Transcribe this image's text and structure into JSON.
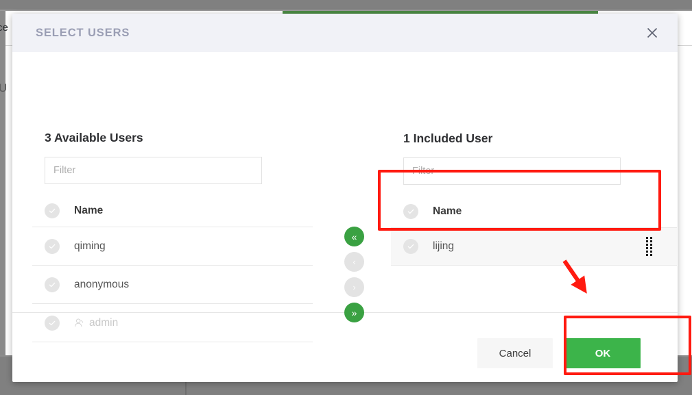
{
  "background": {
    "fragment_top_left": "ce",
    "fragment_left": "U"
  },
  "dialog": {
    "title": "SELECT USERS",
    "close_icon": "close-icon"
  },
  "available": {
    "heading": "3 Available Users",
    "filter_placeholder": "Filter",
    "column_header": "Name",
    "rows": [
      {
        "name": "qiming",
        "icon": "",
        "dim": false
      },
      {
        "name": "anonymous",
        "icon": "",
        "dim": false
      },
      {
        "name": "admin",
        "icon": "user-icon",
        "dim": true
      }
    ]
  },
  "included": {
    "heading": "1 Included User",
    "filter_placeholder": "Filter",
    "column_header": "Name",
    "rows": [
      {
        "name": "lijing",
        "icon": "",
        "dim": false,
        "drag_handle": true,
        "highlighted": true
      }
    ]
  },
  "transfer": {
    "move_all_left": "«",
    "move_left": "‹",
    "move_right": "›",
    "move_all_right": "»"
  },
  "footer": {
    "cancel_label": "Cancel",
    "ok_label": "OK"
  },
  "colors": {
    "accent_green": "#3cb44a",
    "button_green": "#3aa142",
    "header_bg": "#f1f2f7",
    "title_text": "#9a9eb4",
    "annotation_red": "#ff1a10",
    "backdrop_gray": "#808080"
  }
}
